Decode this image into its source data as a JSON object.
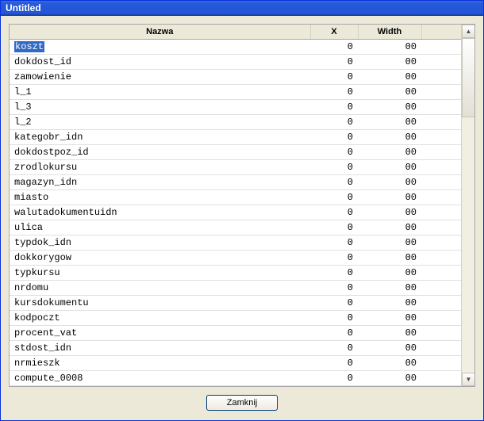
{
  "window": {
    "title": "Untitled"
  },
  "columns": {
    "name": "Nazwa",
    "x": "X",
    "width": "Width"
  },
  "rows": [
    {
      "name": "koszt",
      "x": "0",
      "width": "00",
      "selected": true
    },
    {
      "name": "dokdost_id",
      "x": "0",
      "width": "00"
    },
    {
      "name": "zamowienie",
      "x": "0",
      "width": "00"
    },
    {
      "name": "l_1",
      "x": "0",
      "width": "00"
    },
    {
      "name": "l_3",
      "x": "0",
      "width": "00"
    },
    {
      "name": "l_2",
      "x": "0",
      "width": "00"
    },
    {
      "name": "kategobr_idn",
      "x": "0",
      "width": "00"
    },
    {
      "name": "dokdostpoz_id",
      "x": "0",
      "width": "00"
    },
    {
      "name": "zrodlokursu",
      "x": "0",
      "width": "00"
    },
    {
      "name": "magazyn_idn",
      "x": "0",
      "width": "00"
    },
    {
      "name": "miasto",
      "x": "0",
      "width": "00"
    },
    {
      "name": "walutadokumentuidn",
      "x": "0",
      "width": "00"
    },
    {
      "name": "ulica",
      "x": "0",
      "width": "00"
    },
    {
      "name": "typdok_idn",
      "x": "0",
      "width": "00"
    },
    {
      "name": "dokkorygow",
      "x": "0",
      "width": "00"
    },
    {
      "name": "typkursu",
      "x": "0",
      "width": "00"
    },
    {
      "name": "nrdomu",
      "x": "0",
      "width": "00"
    },
    {
      "name": "kursdokumentu",
      "x": "0",
      "width": "00"
    },
    {
      "name": "kodpoczt",
      "x": "0",
      "width": "00"
    },
    {
      "name": "procent_vat",
      "x": "0",
      "width": "00"
    },
    {
      "name": "stdost_idn",
      "x": "0",
      "width": "00"
    },
    {
      "name": "nrmieszk",
      "x": "0",
      "width": "00"
    },
    {
      "name": "compute_0008",
      "x": "0",
      "width": "00"
    }
  ],
  "buttons": {
    "close": "Zamknij"
  }
}
